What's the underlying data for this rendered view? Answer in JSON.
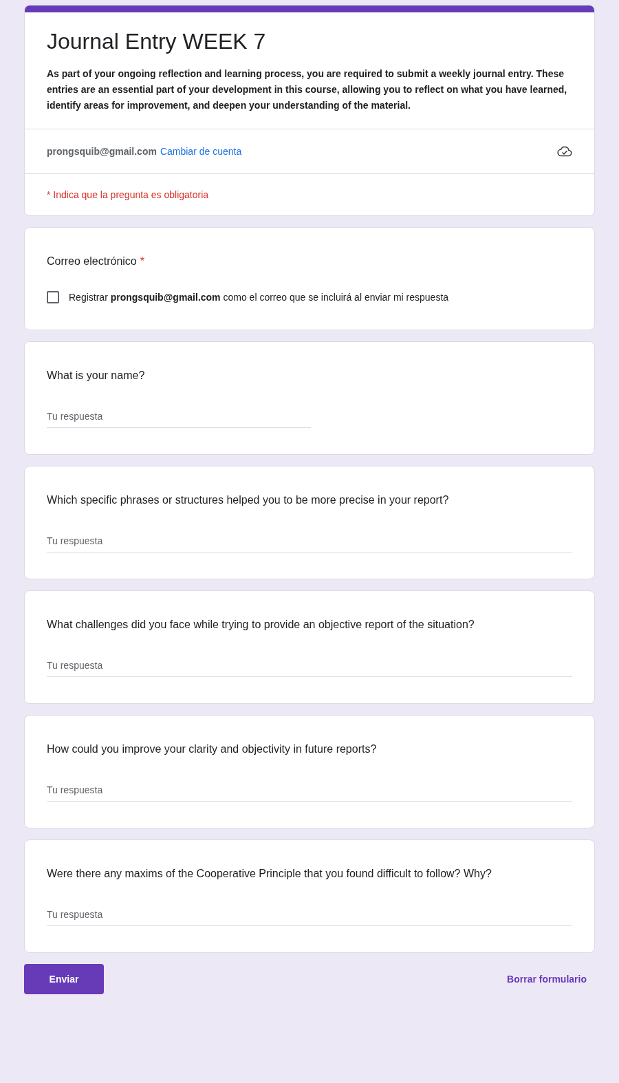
{
  "form": {
    "title": "Journal Entry WEEK 7",
    "description": "As part of your ongoing reflection and learning process, you are required to submit a weekly journal entry. These entries are an essential part of your development in this course, allowing you to reflect on what you have learned, identify areas for improvement, and deepen your understanding of the material."
  },
  "account": {
    "email": "prongsquib@gmail.com",
    "switch_link": "Cambiar de cuenta"
  },
  "required_notice": "* Indica que la pregunta es obligatoria",
  "questions": [
    {
      "kind": "checkbox",
      "title": "Correo electrónico",
      "required_mark": "*",
      "label": "Registrar **prongsquib@gmail.com** como el correo que se incluirá al enviar mi respuesta",
      "checked": false
    },
    {
      "kind": "short",
      "title": "What is your name?",
      "placeholder": "Tu respuesta"
    },
    {
      "kind": "paragraph",
      "title": "Which specific phrases or structures helped you to be more precise in your report?",
      "placeholder": "Tu respuesta"
    },
    {
      "kind": "paragraph",
      "title": "What challenges did you face while trying to provide an objective report of the situation?",
      "placeholder": "Tu respuesta"
    },
    {
      "kind": "paragraph",
      "title": "How could you improve your clarity and objectivity in future reports?",
      "placeholder": "Tu respuesta"
    },
    {
      "kind": "paragraph",
      "title": "Were there any maxims of the Cooperative Principle that you found difficult to follow? Why?",
      "placeholder": "Tu respuesta"
    }
  ],
  "actions": {
    "submit": "Enviar",
    "clear": "Borrar formulario"
  }
}
